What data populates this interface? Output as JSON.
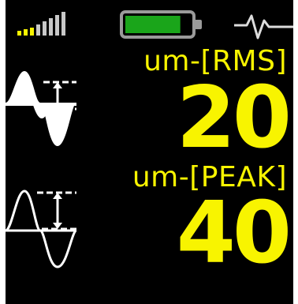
{
  "status": {
    "signal_icon": "signal-strength-icon",
    "signal_bars_filled": 3,
    "signal_bars_total": 6,
    "battery_icon": "battery-icon",
    "battery_level": 0.85,
    "waveform_icon": "waveform-pulse-icon"
  },
  "colors": {
    "background": "#000000",
    "accent": "#f8f400",
    "battery_fill": "#1aa51a",
    "battery_frame": "#9a9a9a"
  },
  "measurements": {
    "rms": {
      "unit": "um-[RMS]",
      "value": "20",
      "icon": "sine-wave-rms-icon"
    },
    "peak": {
      "unit": "um-[PEAK]",
      "value": "40",
      "icon": "sine-wave-peak-icon"
    }
  }
}
